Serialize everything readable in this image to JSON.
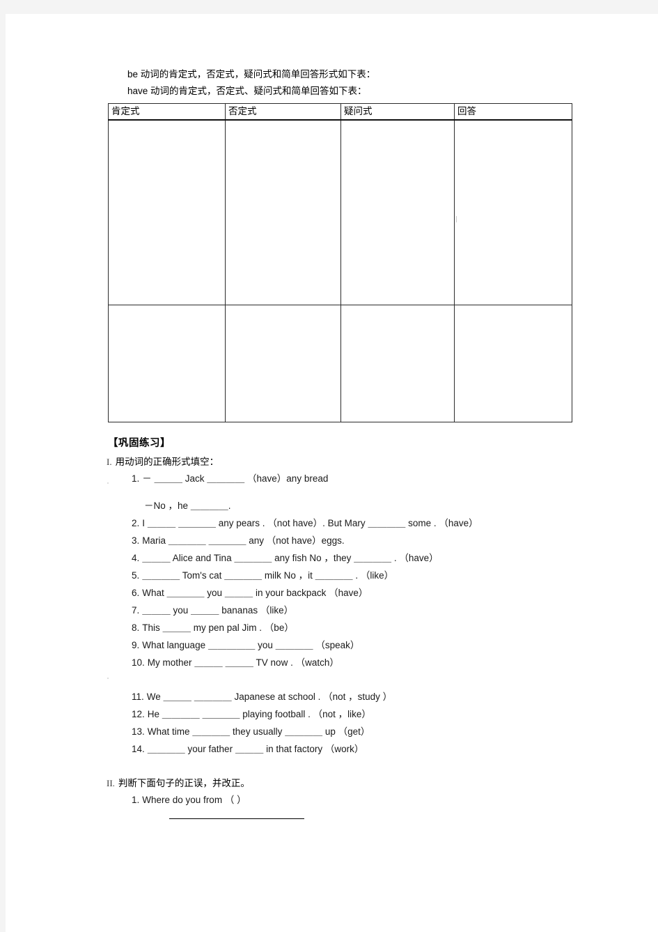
{
  "document": {
    "intro_lines": [
      "be 动词的肯定式，否定式，疑问式和简单回答形式如下表：",
      "have 动词的肯定式，否定式、疑问式和简单回答如下表："
    ],
    "table": {
      "headers": [
        "肯定式",
        "否定式",
        "疑问式",
        "回答"
      ],
      "rows": [
        [
          "",
          "",
          "",
          ""
        ],
        [
          "",
          "",
          "",
          ""
        ]
      ]
    },
    "practice_heading": "【巩固练习】",
    "sections": [
      {
        "numeral": "I.",
        "title": "用动词的正确形式填空：",
        "items": [
          {
            "num": "1.",
            "text": "－ ＿＿＿ Jack ＿＿＿＿  （have）any bread"
          },
          {
            "num": "",
            "text": "－No ，he ＿＿＿＿.",
            "indented": true
          },
          {
            "num": "2.",
            "text": "I ＿＿＿ ＿＿＿＿ any pears .  （not have）. But Mary ＿＿＿＿ some .  （have）"
          },
          {
            "num": "3.",
            "text": "Maria ＿＿＿＿ ＿＿＿＿ any  （not have）eggs."
          },
          {
            "num": "4.",
            "text": "＿＿＿ Alice and Tina ＿＿＿＿ any fish   No ，they ＿＿＿＿ .  （have）"
          },
          {
            "num": "5.",
            "text": "＿＿＿＿ Tom's cat ＿＿＿＿ milk   No ，it ＿＿＿＿ .  （like）"
          },
          {
            "num": "6.",
            "text": "What ＿＿＿＿ you ＿＿＿ in your backpack   （have）"
          },
          {
            "num": "7.",
            "text": "＿＿＿ you ＿＿＿ bananas   （like）"
          },
          {
            "num": "8.",
            "text": "This ＿＿＿ my pen pal Jim .  （be）"
          },
          {
            "num": "9.",
            "text": "What language ＿＿＿＿＿ you ＿＿＿＿   （speak）"
          },
          {
            "num": "10.",
            "text": "My mother ＿＿＿ ＿＿＿ TV now .  （watch）"
          },
          {
            "num": "11.",
            "text": "We ＿＿＿ ＿＿＿＿ Japanese at school .  （not ，study ）",
            "gap_before": true
          },
          {
            "num": "12.",
            "text": "He ＿＿＿＿ ＿＿＿＿ playing football .  （not ，like）"
          },
          {
            "num": "13.",
            "text": "What time ＿＿＿＿ they usually ＿＿＿＿ up   （get）"
          },
          {
            "num": "14.",
            "text": "＿＿＿＿ your father ＿＿＿ in that factory   （work）"
          }
        ]
      },
      {
        "numeral": "II.",
        "title": "判断下面句子的正误，并改正。",
        "items": [
          {
            "num": "1.",
            "text": "Where do you from   （      ）"
          }
        ],
        "has_answer_rule": true
      }
    ]
  },
  "colors": {
    "page_background": "#ffffff",
    "canvas_background": "#f4f4f4",
    "text": "#000000",
    "table_border": "#2b2b2b",
    "table_header_rule": "#111111"
  }
}
